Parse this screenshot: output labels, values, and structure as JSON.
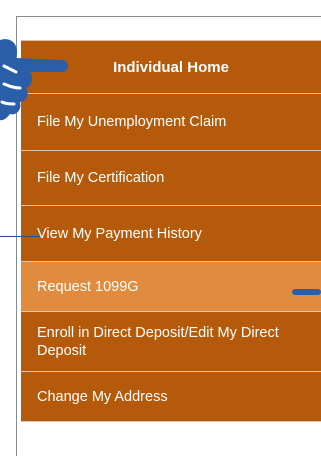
{
  "menu": {
    "header": "Individual Home",
    "items": [
      {
        "label": "File My Unemployment Claim"
      },
      {
        "label": "File My Certification"
      },
      {
        "label": "View My Payment History"
      },
      {
        "label": "Request 1099G",
        "highlighted": true
      },
      {
        "label": "Enroll in Direct Deposit/Edit My Direct Deposit"
      },
      {
        "label": "Change My Address"
      }
    ]
  },
  "colors": {
    "menu_background": "#b55a0a",
    "highlight_background": "#e08b3e",
    "annotation_blue": "#2b5ea8",
    "text": "#ffffff"
  },
  "icons": {
    "annotation_hand": "pointing-hand-icon"
  }
}
